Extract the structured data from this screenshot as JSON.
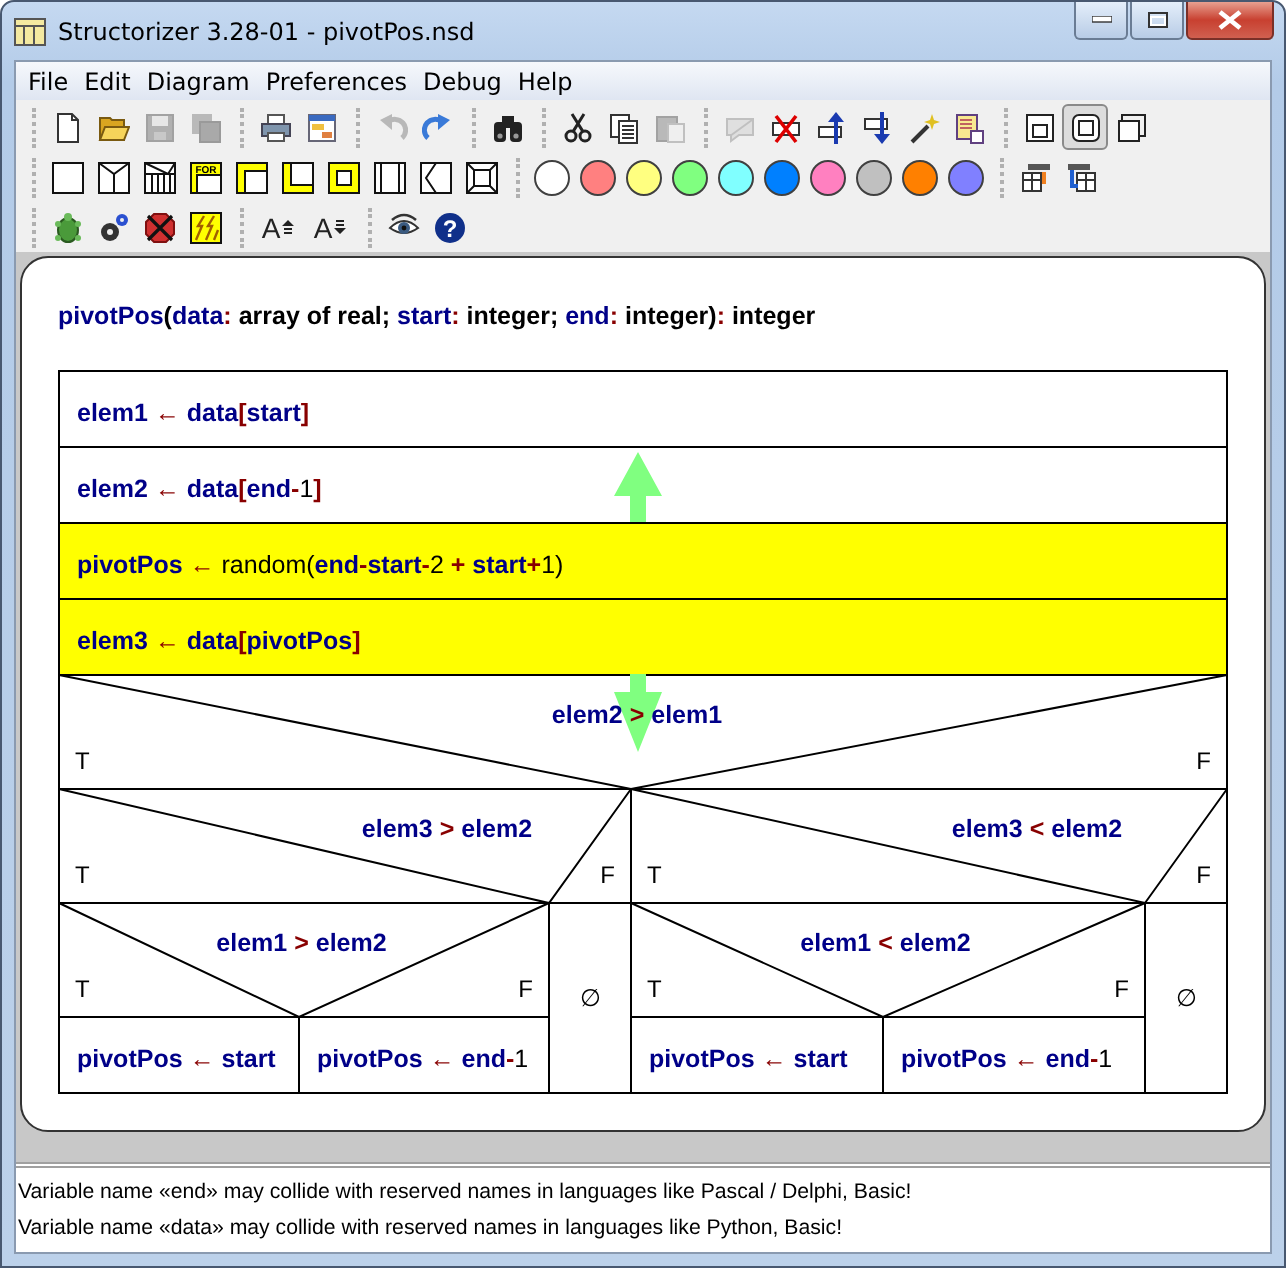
{
  "window": {
    "title": "Structorizer 3.28-01 - pivotPos.nsd"
  },
  "menu": [
    "File",
    "Edit",
    "Diagram",
    "Preferences",
    "Debug",
    "Help"
  ],
  "toolbar": {
    "rows": [
      [
        [
          {
            "kind": "new",
            "disabled": false
          },
          {
            "kind": "open",
            "disabled": false
          },
          {
            "kind": "save",
            "disabled": true
          },
          {
            "kind": "save-all",
            "disabled": true
          }
        ],
        [
          {
            "kind": "print",
            "disabled": false
          },
          {
            "kind": "picture",
            "disabled": false
          }
        ],
        [
          {
            "kind": "undo",
            "disabled": true
          },
          {
            "kind": "redo",
            "disabled": false
          }
        ],
        [
          {
            "kind": "find",
            "disabled": false
          }
        ],
        [
          {
            "kind": "cut",
            "disabled": false
          },
          {
            "kind": "copy",
            "disabled": false
          },
          {
            "kind": "paste",
            "disabled": true
          }
        ],
        [
          {
            "kind": "comment",
            "disabled": true
          },
          {
            "kind": "delete",
            "disabled": false
          },
          {
            "kind": "move-up",
            "disabled": false
          },
          {
            "kind": "move-down",
            "disabled": false
          },
          {
            "kind": "wand",
            "disabled": false
          },
          {
            "kind": "sub",
            "disabled": false
          }
        ],
        [
          {
            "kind": "view-a",
            "disabled": false,
            "selected": false
          },
          {
            "kind": "view-b",
            "disabled": false,
            "selected": true
          },
          {
            "kind": "view-c",
            "disabled": false,
            "selected": false
          }
        ]
      ],
      [
        [
          {
            "kind": "instruction",
            "disabled": false
          },
          {
            "kind": "if",
            "disabled": false
          },
          {
            "kind": "case",
            "disabled": false
          },
          {
            "kind": "for",
            "label": "FOR",
            "disabled": false
          },
          {
            "kind": "while",
            "disabled": false
          },
          {
            "kind": "repeat",
            "disabled": false
          },
          {
            "kind": "forever",
            "disabled": false
          },
          {
            "kind": "call",
            "disabled": false
          },
          {
            "kind": "jump",
            "disabled": false
          },
          {
            "kind": "parallel",
            "disabled": false
          }
        ],
        [
          {
            "kind": "color",
            "color": "#ffffff",
            "disabled": false
          },
          {
            "kind": "color",
            "color": "#ff8080",
            "disabled": false
          },
          {
            "kind": "color",
            "color": "#ffff80",
            "disabled": false
          },
          {
            "kind": "color",
            "color": "#80ff80",
            "disabled": false
          },
          {
            "kind": "color",
            "color": "#80ffff",
            "disabled": false
          },
          {
            "kind": "color",
            "color": "#0080ff",
            "disabled": false
          },
          {
            "kind": "color",
            "color": "#ff80c0",
            "disabled": false
          },
          {
            "kind": "color",
            "color": "#c0c0c0",
            "disabled": false
          },
          {
            "kind": "color",
            "color": "#ff8000",
            "disabled": false
          },
          {
            "kind": "color",
            "color": "#8080ff",
            "disabled": false
          }
        ],
        [
          {
            "kind": "import",
            "disabled": false
          },
          {
            "kind": "export",
            "disabled": false
          }
        ]
      ],
      [
        [
          {
            "kind": "turtle",
            "disabled": false
          },
          {
            "kind": "gears",
            "disabled": false
          },
          {
            "kind": "stop",
            "disabled": false
          },
          {
            "kind": "try",
            "disabled": false
          }
        ],
        [
          {
            "kind": "font-up",
            "label": "A",
            "disabled": false
          },
          {
            "kind": "font-down",
            "label": "A",
            "disabled": false
          }
        ],
        [
          {
            "kind": "eye",
            "disabled": false
          },
          {
            "kind": "help",
            "label": "?",
            "disabled": false
          }
        ]
      ]
    ]
  },
  "diagram": {
    "header": [
      {
        "t": "pivotPos",
        "kind": "var"
      },
      {
        "t": "(",
        "kind": "kw"
      },
      {
        "t": "data",
        "kind": "var"
      },
      {
        "t": ":",
        "kind": "op"
      },
      {
        "t": " array of real; ",
        "kind": "kw"
      },
      {
        "t": "start",
        "kind": "var"
      },
      {
        "t": ":",
        "kind": "op"
      },
      {
        "t": " integer; ",
        "kind": "kw"
      },
      {
        "t": "end",
        "kind": "var"
      },
      {
        "t": ":",
        "kind": "op"
      },
      {
        "t": " integer)",
        "kind": "kw"
      },
      {
        "t": ":",
        "kind": "op"
      },
      {
        "t": " integer",
        "kind": "kw"
      }
    ],
    "elements": [
      {
        "kind": "instruction",
        "color": "#ffffff",
        "tokens": [
          {
            "t": "elem1",
            "kind": "var"
          },
          {
            "t": " ← ",
            "kind": "op"
          },
          {
            "t": "data",
            "kind": "var"
          },
          {
            "t": "[",
            "kind": "op"
          },
          {
            "t": "start",
            "kind": "var"
          },
          {
            "t": "]",
            "kind": "op"
          }
        ]
      },
      {
        "kind": "instruction",
        "color": "#ffffff",
        "tokens": [
          {
            "t": "elem2",
            "kind": "var"
          },
          {
            "t": " ← ",
            "kind": "op"
          },
          {
            "t": "data",
            "kind": "var"
          },
          {
            "t": "[",
            "kind": "op"
          },
          {
            "t": "end",
            "kind": "var"
          },
          {
            "t": "-",
            "kind": "op"
          },
          {
            "t": "1",
            "kind": "lit"
          },
          {
            "t": "]",
            "kind": "op"
          }
        ]
      },
      {
        "kind": "instruction",
        "color": "#ffff00",
        "tokens": [
          {
            "t": "pivotPos",
            "kind": "var"
          },
          {
            "t": " ← ",
            "kind": "op"
          },
          {
            "t": "random(",
            "kind": "lit"
          },
          {
            "t": "end",
            "kind": "var"
          },
          {
            "t": "-",
            "kind": "op"
          },
          {
            "t": "start",
            "kind": "var"
          },
          {
            "t": "-",
            "kind": "op"
          },
          {
            "t": "2",
            "kind": "lit"
          },
          {
            "t": " + ",
            "kind": "op"
          },
          {
            "t": "start",
            "kind": "var"
          },
          {
            "t": "+",
            "kind": "op"
          },
          {
            "t": "1)",
            "kind": "lit"
          }
        ]
      },
      {
        "kind": "instruction",
        "color": "#ffff00",
        "tokens": [
          {
            "t": "elem3",
            "kind": "var"
          },
          {
            "t": " ← ",
            "kind": "op"
          },
          {
            "t": "data",
            "kind": "var"
          },
          {
            "t": "[",
            "kind": "op"
          },
          {
            "t": "pivotPos",
            "kind": "var"
          },
          {
            "t": "]",
            "kind": "op"
          }
        ]
      },
      {
        "kind": "if",
        "true_label": "T",
        "false_label": "F",
        "condition": [
          {
            "t": "elem2",
            "kind": "var"
          },
          {
            "t": " > ",
            "kind": "op"
          },
          {
            "t": "elem1",
            "kind": "var"
          }
        ],
        "then": [
          {
            "kind": "if",
            "true_label": "T",
            "false_label": "F",
            "condition": [
              {
                "t": "elem3",
                "kind": "var"
              },
              {
                "t": " > ",
                "kind": "op"
              },
              {
                "t": "elem2",
                "kind": "var"
              }
            ],
            "then": [
              {
                "kind": "if",
                "true_label": "T",
                "false_label": "F",
                "condition": [
                  {
                    "t": "elem1",
                    "kind": "var"
                  },
                  {
                    "t": " > ",
                    "kind": "op"
                  },
                  {
                    "t": "elem2",
                    "kind": "var"
                  }
                ],
                "then": [
                  {
                    "kind": "instruction",
                    "color": "#ffffff",
                    "tokens": [
                      {
                        "t": "pivotPos",
                        "kind": "var"
                      },
                      {
                        "t": " ← ",
                        "kind": "op"
                      },
                      {
                        "t": "start",
                        "kind": "var"
                      }
                    ]
                  }
                ],
                "else": [
                  {
                    "kind": "instruction",
                    "color": "#ffffff",
                    "tokens": [
                      {
                        "t": "pivotPos",
                        "kind": "var"
                      },
                      {
                        "t": " ← ",
                        "kind": "op"
                      },
                      {
                        "t": "end",
                        "kind": "var"
                      },
                      {
                        "t": "-",
                        "kind": "op"
                      },
                      {
                        "t": "1",
                        "kind": "lit"
                      }
                    ]
                  }
                ]
              }
            ],
            "else": [
              {
                "kind": "empty",
                "label": "∅"
              }
            ]
          }
        ],
        "else": [
          {
            "kind": "if",
            "true_label": "T",
            "false_label": "F",
            "condition": [
              {
                "t": "elem3",
                "kind": "var"
              },
              {
                "t": " < ",
                "kind": "op"
              },
              {
                "t": "elem2",
                "kind": "var"
              }
            ],
            "then": [
              {
                "kind": "if",
                "true_label": "T",
                "false_label": "F",
                "condition": [
                  {
                    "t": "elem1",
                    "kind": "var"
                  },
                  {
                    "t": " < ",
                    "kind": "op"
                  },
                  {
                    "t": "elem2",
                    "kind": "var"
                  }
                ],
                "then": [
                  {
                    "kind": "instruction",
                    "color": "#ffffff",
                    "tokens": [
                      {
                        "t": "pivotPos",
                        "kind": "var"
                      },
                      {
                        "t": " ← ",
                        "kind": "op"
                      },
                      {
                        "t": "start",
                        "kind": "var"
                      }
                    ]
                  }
                ],
                "else": [
                  {
                    "kind": "instruction",
                    "color": "#ffffff",
                    "tokens": [
                      {
                        "t": "pivotPos",
                        "kind": "var"
                      },
                      {
                        "t": " ← ",
                        "kind": "op"
                      },
                      {
                        "t": "end",
                        "kind": "var"
                      },
                      {
                        "t": "-",
                        "kind": "op"
                      },
                      {
                        "t": "1",
                        "kind": "lit"
                      }
                    ]
                  }
                ]
              }
            ],
            "else": [
              {
                "kind": "empty",
                "label": "∅"
              }
            ]
          }
        ]
      }
    ]
  },
  "messages": [
    "Variable name «end» may collide with reserved names in languages like Pascal / Delphi, Basic!",
    "Variable name «data» may collide with reserved names in languages like Python, Basic!"
  ]
}
